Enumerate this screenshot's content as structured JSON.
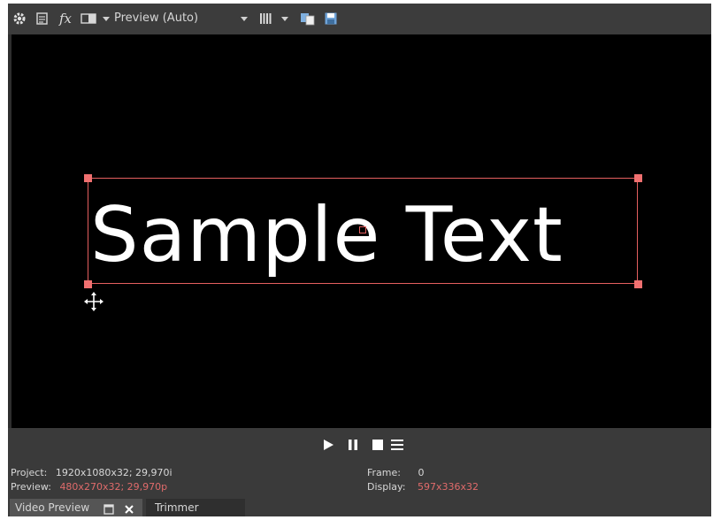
{
  "toolbar": {
    "icons": [
      "gear-icon",
      "properties-icon",
      "fx-icon",
      "split-screen-icon",
      "grid-icon",
      "copy-snapshot-icon",
      "save-snapshot-icon"
    ],
    "fx_label": "fx",
    "preview_quality": "Preview (Auto)"
  },
  "viewport": {
    "overlay_text": "Sample Text",
    "selection_color": "#e55f5f"
  },
  "transport": {
    "icons": [
      "play-icon",
      "pause-icon",
      "stop-icon",
      "menu-icon"
    ]
  },
  "status": {
    "project_label": "Project:",
    "project_value": "1920x1080x32; 29,970i",
    "preview_label": "Preview:",
    "preview_value": "480x270x32; 29,970p",
    "frame_label": "Frame:",
    "frame_value": "0",
    "display_label": "Display:",
    "display_value": "597x336x32",
    "highlight_color": "#e06b6b"
  },
  "tabs": {
    "video_preview": "Video Preview",
    "trimmer": "Trimmer"
  }
}
